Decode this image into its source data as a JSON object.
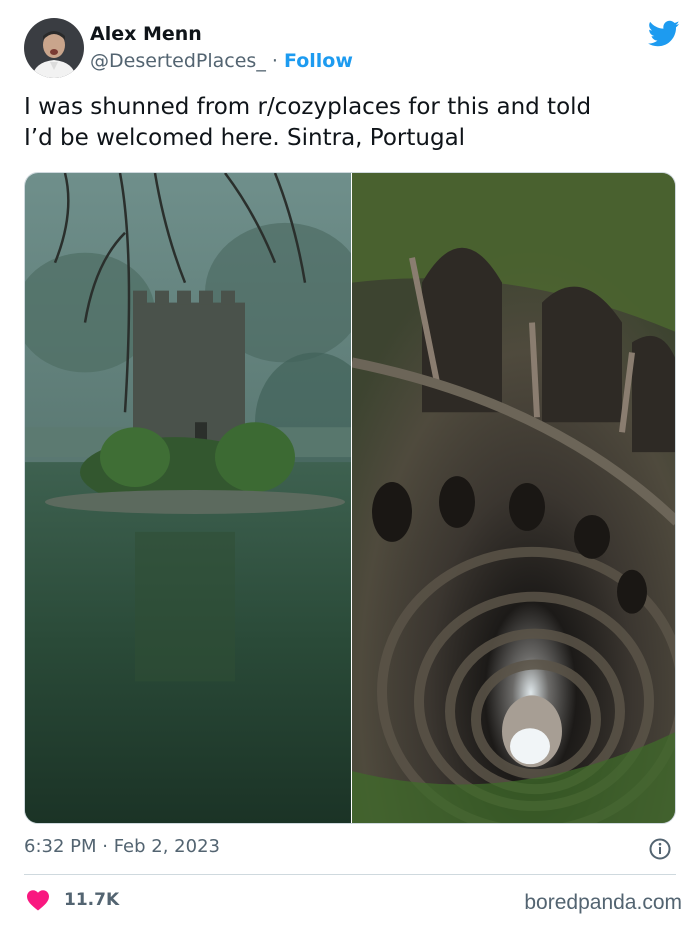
{
  "author": {
    "display_name": "Alex Menn",
    "handle": "@DesertedPlaces_",
    "separator": "·",
    "follow_label": "Follow",
    "avatar_icon": "avatar-portrait"
  },
  "tweet": {
    "text_line1": "I was shunned from r/cozyplaces for this and told",
    "text_line2": "I’d be welcomed here. Sintra, Portugal"
  },
  "media": {
    "left_photo": "castle-tower-in-lake-photo",
    "right_photo": "spiral-initiation-well-photo"
  },
  "meta": {
    "timestamp": "6:32 PM · Feb 2, 2023",
    "info_icon": "info-icon"
  },
  "engagement": {
    "likes": "11.7K",
    "heart_color": "#f91880"
  },
  "watermark": "boredpanda.com",
  "colors": {
    "twitter_blue": "#1d9bf0",
    "secondary_text": "#536471",
    "border": "#cfd9de"
  }
}
